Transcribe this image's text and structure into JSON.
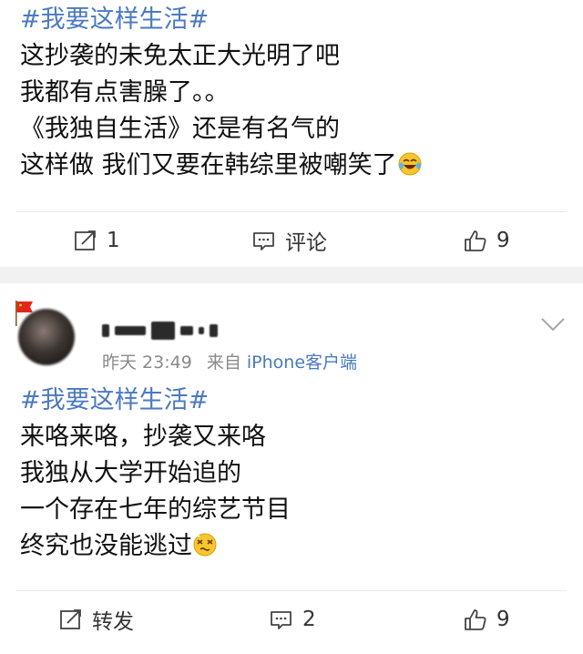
{
  "post1": {
    "hashtag": "#我要这样生活#",
    "lines": [
      "这抄袭的未免太正大光明了吧",
      "我都有点害臊了。。",
      "《我独自生活》还是有名气的",
      "这样做 我们又要在韩综里被嘲笑了"
    ],
    "emoji": "laughing-tears-emoji",
    "actions": {
      "repost": "1",
      "comment": "评论",
      "like": "9"
    }
  },
  "post2": {
    "nickname_blurred": true,
    "time": "昨天 23:49",
    "source_prefix": "来自",
    "source": "iPhone客户端",
    "hashtag": "#我要这样生活#",
    "lines": [
      "来咯来咯，抄袭又来咯",
      "我独从大学开始追的",
      "一个存在七年的综艺节目",
      "终究也没能逃过"
    ],
    "emoji": "dizzy-face-emoji",
    "actions": {
      "repost": "转发",
      "comment": "2",
      "like": "9"
    }
  },
  "colors": {
    "link": "#4a79c1",
    "meta": "#8a8a8a",
    "separator": "#f1f1f1"
  },
  "icons": [
    "share-icon",
    "comment-icon",
    "like-icon",
    "chevron-down-icon",
    "flag-icon"
  ]
}
